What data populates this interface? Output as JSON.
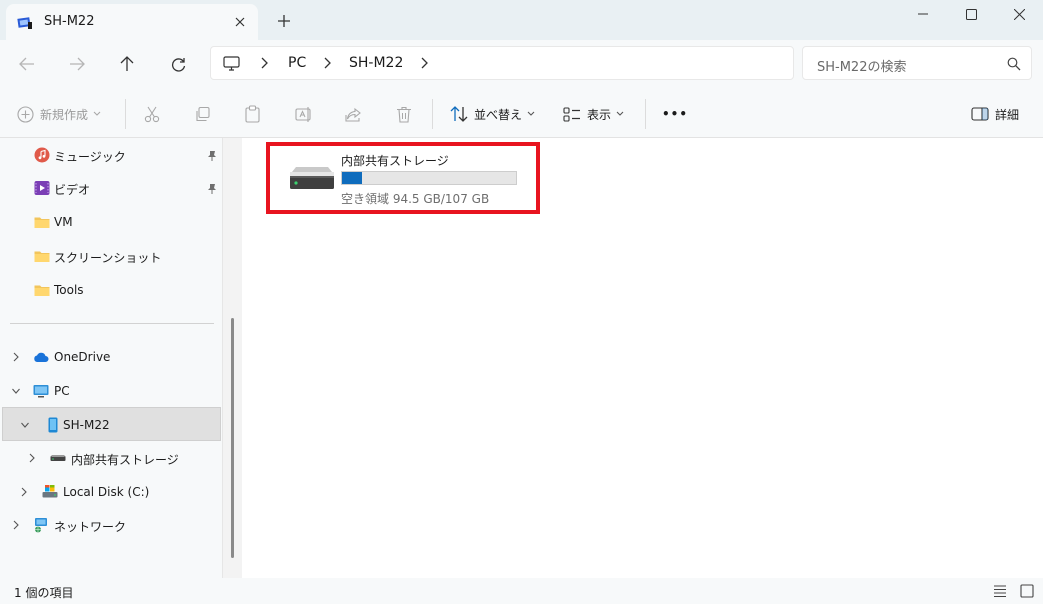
{
  "window": {
    "tab_title": "SH-M22",
    "new_tab": "+"
  },
  "address": {
    "crumbs": [
      "PC",
      "SH-M22"
    ],
    "search_placeholder": "SH-M22の検索"
  },
  "toolbar": {
    "new_label": "新規作成",
    "sort_label": "並べ替え",
    "view_label": "表示",
    "more_label": "•••",
    "details_label": "詳細"
  },
  "sidebar": {
    "items": [
      {
        "label": "ミュージック",
        "icon": "music-icon",
        "pinned": true
      },
      {
        "label": "ビデオ",
        "icon": "video-icon",
        "pinned": true
      },
      {
        "label": "VM",
        "icon": "folder-icon"
      },
      {
        "label": "スクリーンショット",
        "icon": "folder-icon"
      },
      {
        "label": "Tools",
        "icon": "folder-icon"
      },
      {
        "label": "OneDrive",
        "icon": "cloud-icon",
        "expander": "collapsed"
      },
      {
        "label": "PC",
        "icon": "pc-icon",
        "expander": "expanded"
      },
      {
        "label": "SH-M22",
        "icon": "phone-icon",
        "expander": "expanded",
        "selected": true
      },
      {
        "label": "内部共有ストレージ",
        "icon": "storage-icon",
        "expander": "collapsed"
      },
      {
        "label": "Local Disk (C:)",
        "icon": "disk-icon",
        "expander": "collapsed"
      },
      {
        "label": "ネットワーク",
        "icon": "network-icon",
        "expander": "collapsed"
      }
    ]
  },
  "content": {
    "drive": {
      "name": "内部共有ストレージ",
      "free_text": "空き領域 94.5 GB/107 GB",
      "used_fraction": 0.117,
      "highlight_color": "#e8141f"
    }
  },
  "status": {
    "item_count": "1 個の項目"
  },
  "colors": {
    "accent": "#0f6cbd",
    "highlight": "#e8141f"
  }
}
